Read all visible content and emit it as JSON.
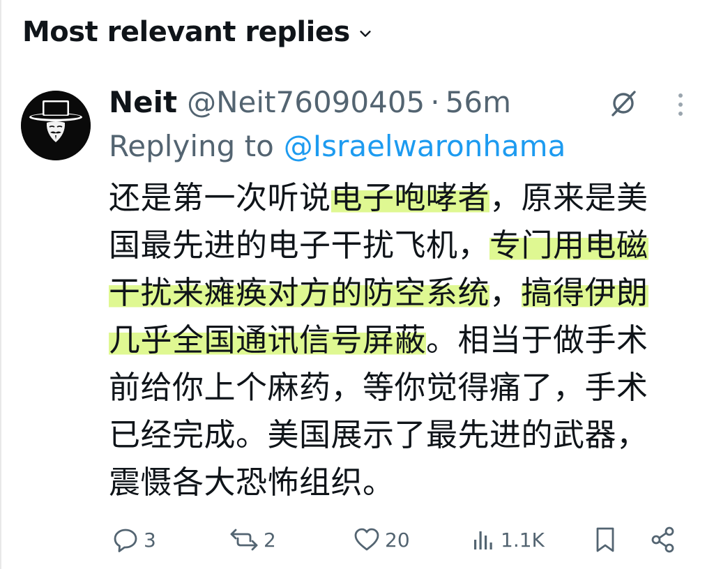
{
  "header": {
    "title": "Most relevant replies"
  },
  "tweet": {
    "display_name": "Neit",
    "handle": "@Neit76090405",
    "separator": "·",
    "time": "56m",
    "replying_prefix": "Replying to",
    "replying_handle": "@Israelwaronhama",
    "text_segments": {
      "s1": "还是第一次听说",
      "s2": "电子咆哮者",
      "s3": "，原来是美",
      "s4": "国最先进的电子干扰飞机，",
      "s5": "专门用电磁",
      "s6": "干扰来瘫痪对方的防空系统",
      "s7": "，",
      "s8": "搞得伊朗",
      "s9": "几乎全国通讯信号屏蔽",
      "s10": "。相当于做手术",
      "s11": "前给你上个麻药，等你觉得痛了，手术",
      "s12": "已经完成。美国展示了最先进的武器，",
      "s13": "震慑各大恐怖组织。"
    },
    "highlight_color": "#d4f56e"
  },
  "actions": {
    "replies": "3",
    "reposts": "2",
    "likes": "20",
    "views": "1.1K"
  },
  "colors": {
    "text_primary": "#0f1419",
    "text_secondary": "#536471",
    "link": "#1d9bf0"
  },
  "icons": {
    "header_chevron": "chevron-down-icon",
    "avatar": "avatar-image",
    "grok": "grok-icon",
    "more": "more-vertical-icon",
    "reply": "reply-icon",
    "repost": "repost-icon",
    "like": "heart-icon",
    "views": "views-icon",
    "bookmark": "bookmark-icon",
    "share": "share-icon"
  }
}
